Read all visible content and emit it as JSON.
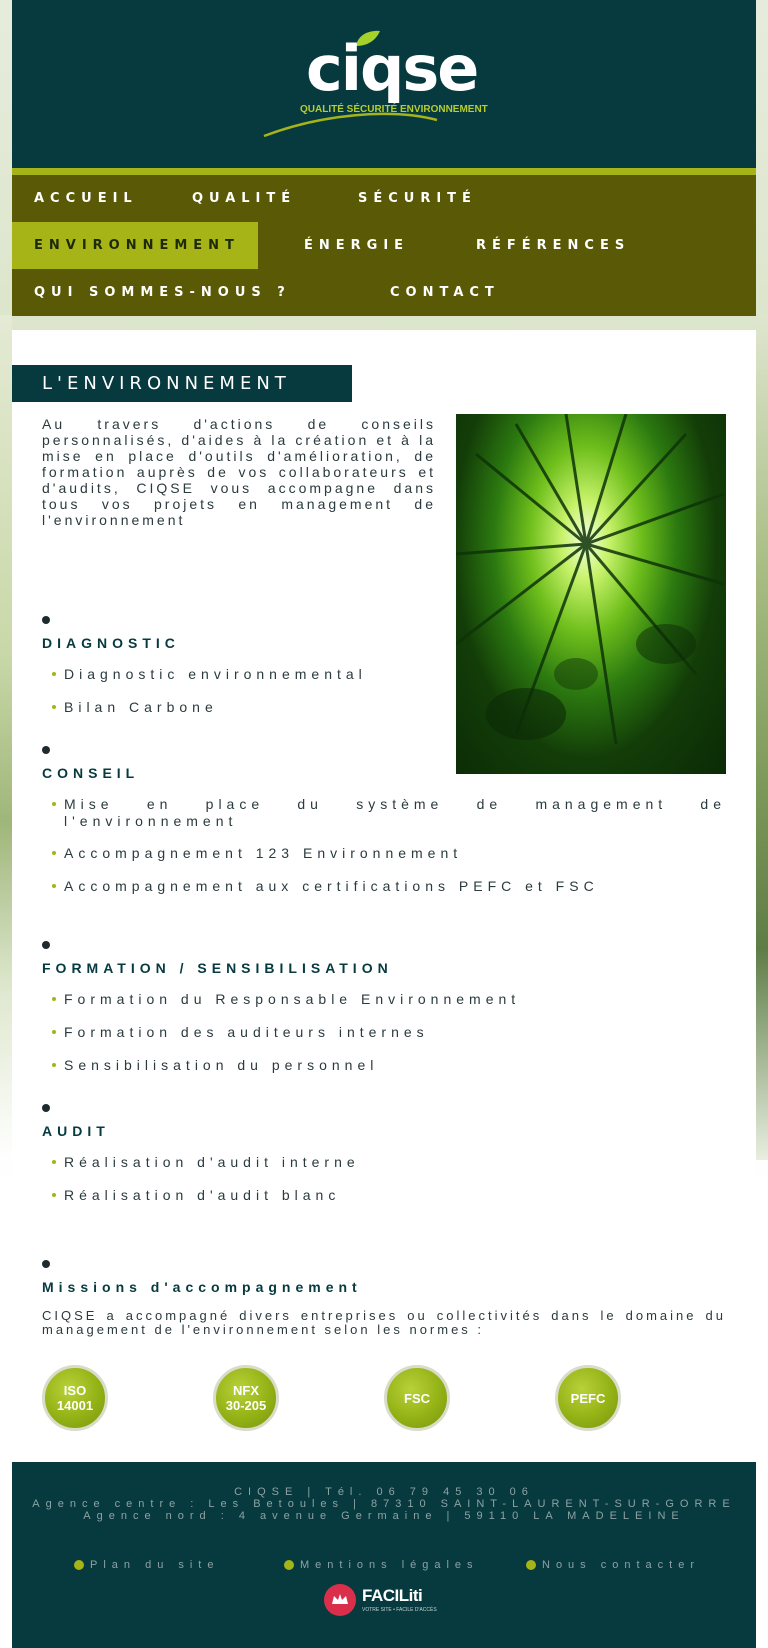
{
  "brand": {
    "name": "ciqse",
    "tagline": "QUALITÉ SÉCURITÉ ENVIRONNEMENT"
  },
  "nav": {
    "accueil": "ACCUEIL",
    "qualite": "QUALITÉ",
    "securite": "SÉCURITÉ",
    "environnement": "ENVIRONNEMENT",
    "energie": "ÉNERGIE",
    "references": "RÉFÉRENCES",
    "qui": "QUI SOMMES-NOUS ?",
    "contact": "CONTACT"
  },
  "page": {
    "title": "L'ENVIRONNEMENT",
    "intro": "Au travers d'actions de conseils personnalisés, d'aides à la création et à la mise en place d'outils d'amélioration, de formation auprès de vos collaborateurs et d'audits, CIQSE vous accompagne dans tous vos projets en management de l'environnement"
  },
  "sections": {
    "diagnostic": {
      "title": "DIAGNOSTIC",
      "items": [
        "Diagnostic environnemental",
        "Bilan Carbone"
      ]
    },
    "conseil": {
      "title": "CONSEIL",
      "items": [
        "Mise en place du système de management de l'environnement",
        "Accompagnement 123 Environnement",
        "Accompagnement aux certifications PEFC et FSC"
      ]
    },
    "formation": {
      "title": "FORMATION / SENSIBILISATION",
      "items": [
        "Formation du Responsable Environnement",
        "Formation des auditeurs internes",
        "Sensibilisation du personnel"
      ]
    },
    "audit": {
      "title": "AUDIT",
      "items": [
        "Réalisation d'audit interne",
        "Réalisation d'audit blanc"
      ]
    },
    "missions": {
      "title": "Missions d'accompagnement",
      "text": "CIQSE a accompagné divers entreprises ou collectivités dans le domaine du management de l'environnement selon les normes :"
    }
  },
  "badges": {
    "iso_1": "ISO",
    "iso_2": "14001",
    "nfx_1": "NFX",
    "nfx_2": "30-205",
    "fsc": "FSC",
    "pefc": "PEFC"
  },
  "footer": {
    "line1": "CIQSE | Tél. 06 79 45 30 06",
    "line2": "Agence centre : Les Betoules | 87310 SAINT-LAURENT-SUR-GORRE",
    "line3": "Agence nord : 4 avenue Germaine | 59110 LA MADELEINE",
    "links": {
      "plan": "Plan du site",
      "mentions": "Mentions légales",
      "contact": "Nous contacter"
    },
    "faciliti": {
      "name": "FACILiti",
      "sub": "VOTRE SITE • FACILE D'ACCÈS"
    }
  },
  "colors": {
    "dark_teal": "#063a3f",
    "olive": "#5a5a06",
    "accent_green": "#a6b417"
  }
}
